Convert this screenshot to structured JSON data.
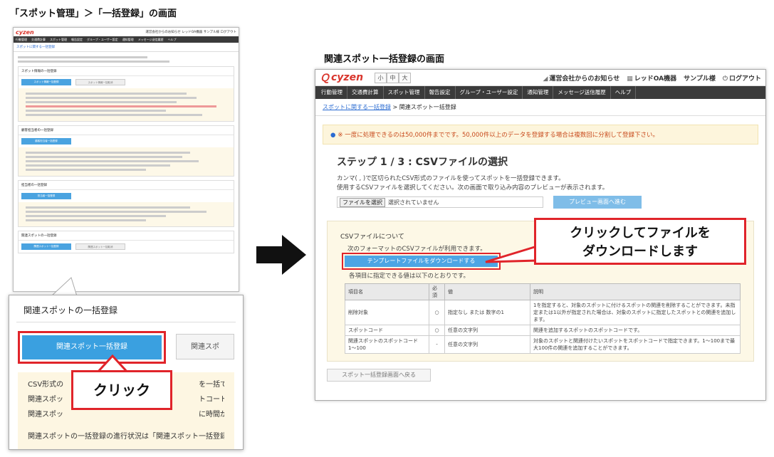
{
  "captions": {
    "left": "「スポット管理」＞「一括登録」の画面",
    "right": "関連スポット一括登録の画面"
  },
  "brand": {
    "logo": "cyzen",
    "logo_color": "#d9352c",
    "accent_red": "#e0242a",
    "button_blue": "#4aa3e0"
  },
  "header": {
    "size_buttons": [
      "小",
      "中",
      "大"
    ],
    "notice_label": "運営会社からのお知らせ",
    "company_label": "レッドOA機器",
    "user_label": "サンプル様",
    "logout_label": "ログアウト"
  },
  "nav": {
    "items": [
      "行動管理",
      "交通費計算",
      "スポット管理",
      "報告設定",
      "グループ・ユーザー設定",
      "通知管理",
      "メッセージ送信履歴",
      "ヘルプ"
    ]
  },
  "left_screen": {
    "crumb": "スポットに関する一括登録",
    "sections": [
      {
        "title": "スポット情報の一括登録",
        "btn": "スポット情報一括登録",
        "btn2": "スポット情報一括取消"
      },
      {
        "title": "顧客担当者の一括登録",
        "btn": "顧客担当者一括登録"
      },
      {
        "title": "担当者の一括登録",
        "btn": "担当者一括登録"
      },
      {
        "title": "関連スポットの一括登録",
        "btn": "関連スポット一括登録",
        "btn2": "関連スポット一括取消"
      }
    ]
  },
  "zoom": {
    "title": "関連スポットの一括登録",
    "primary_button": "関連スポット一括登録",
    "secondary_button": "関連スポ",
    "lines": [
      "CSV形式の",
      "関連スポッ",
      "関連スポッ"
    ],
    "lines_right": [
      "を一括で登",
      "トコードが",
      "に時間が"
    ],
    "footer_line": "関連スポットの一括登録の進行状況は「関連スポット一括登録次"
  },
  "callouts": {
    "click": "クリック",
    "download_line1": "クリックしてファイルを",
    "download_line2": "ダウンロードします"
  },
  "right_screen": {
    "crumb_link": "スポットに関する一括登録",
    "crumb_sep": " > ",
    "crumb_current": "関連スポット一括登録",
    "alert": "※ 一度に処理できるのは50,000件までです。50,000件以上のデータを登録する場合は複数回に分割して登録下さい。",
    "step_title": "ステップ 1 / 3 : CSVファイルの選択",
    "desc1": "カンマ( , )で区切られたCSV形式のファイルを使ってスポットを一括登録できます。",
    "desc2": "使用するCSVファイルを選択してください。次の画面で取り込み内容のプレビューが表示されます。",
    "file_button": "ファイルを選択",
    "file_none": "選択されていません",
    "preview_button": "プレビュー画面へ進む",
    "csv_title": "CSVファイルについて",
    "csv_note": "次のフォーマットのCSVファイルが利用できます。",
    "template_button": "テンプレートファイルをダウンロードする",
    "items_note": "各項目に指定できる値は以下のとおりです。",
    "table": {
      "headers": [
        "項目名",
        "必須",
        "値",
        "説明"
      ],
      "rows": [
        [
          "削除対象",
          "○",
          "指定なし または 数字の1",
          "1を指定すると、対象のスポットに付けるスポットの関連を削除することができます。未指定または1以外が指定された場合は、対象のスポットに指定したスポットとの関連を追加します。"
        ],
        [
          "スポットコード",
          "○",
          "任意の文字列",
          "関連を追加するスポットのスポットコードです。"
        ],
        [
          "関連スポットのスポットコード1〜100",
          "-",
          "任意の文字列",
          "対象のスポットと関連付けたいスポットをスポットコードで指定できます。1〜100まで最大100件の関連を追加することができます。"
        ]
      ]
    },
    "back_button": "スポット一括登録画面へ戻る"
  }
}
